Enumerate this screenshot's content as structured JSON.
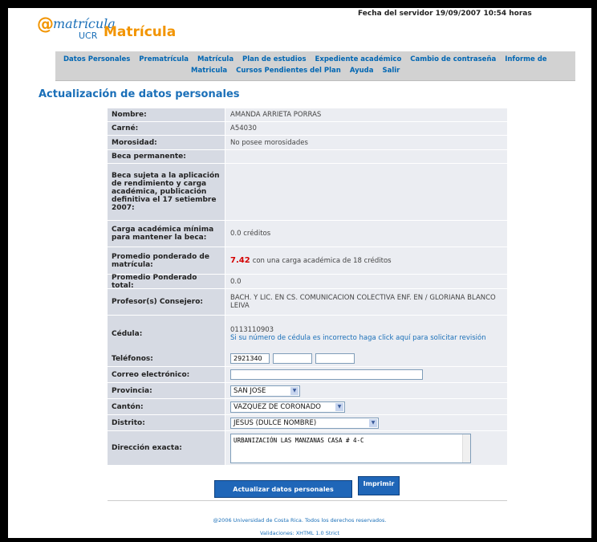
{
  "header": {
    "logo_text": "matrícula",
    "logo_sub": "UCR",
    "title": "Matrícula",
    "server_time": "Fecha del servidor 19/09/2007 10:54 horas"
  },
  "nav": {
    "row1": [
      "Datos Personales",
      "Prematrícula",
      "Matrícula",
      "Plan de estudios",
      "Expediente académico",
      "Cambio de contraseña",
      "Informe de"
    ],
    "row2": [
      "Matricula",
      "Cursos Pendientes del Plan",
      "Ayuda",
      "Salir"
    ]
  },
  "section_title": "Actualización de datos personales",
  "info": {
    "nombre_label": "Nombre:",
    "nombre": "AMANDA ARRIETA PORRAS",
    "carne_label": "Carné:",
    "carne": "A54030",
    "morosidad_label": "Morosidad:",
    "morosidad": "No posee morosidades",
    "beca_perm_label": "Beca permanente:",
    "beca_perm": "",
    "beca_sujeta_label": "Beca sujeta a la aplicación de rendimiento y carga académica, publicación definitiva el 17 setiembre 2007:",
    "beca_sujeta": "",
    "carga_label": "Carga académica mínima para mantener la beca:",
    "carga": "0.0 créditos",
    "promedio_label": "Promedio ponderado de matrícula:",
    "promedio_value": "7.42",
    "promedio_text": "con una carga académica de 18 créditos",
    "promedio_total_label": "Promedio Ponderado total:",
    "promedio_total": "0.0",
    "profesor_label": "Profesor(s) Consejero:",
    "profesor": "BACH. Y LIC. EN CS. COMUNICACION COLECTIVA ENF. EN / GLORIANA BLANCO LEIVA",
    "cedula_label": "Cédula:",
    "cedula": "0113110903",
    "cedula_link": "Si su número de cédula es incorrecto haga click aquí para solicitar revisión"
  },
  "form": {
    "telefonos_label": "Teléfonos:",
    "telefono1": "2921340",
    "telefono2": "",
    "telefono3": "",
    "correo_label": "Correo electrónico:",
    "correo": "",
    "provincia_label": "Provincia:",
    "provincia": "SAN JOSE",
    "canton_label": "Cantón:",
    "canton": "VAZQUEZ DE CORONADO",
    "distrito_label": "Distrito:",
    "distrito": "JESUS (DULCE NOMBRE)",
    "direccion_label": "Dirección exacta:",
    "direccion": "URBANIZACIÓN LAS MANZANAS CASA # 4-C"
  },
  "buttons": {
    "update": "Actualizar datos personales",
    "print": "Imprimir"
  },
  "footer": {
    "copyright": "@2006 Universidad de Costa Rica. Todos los derechos reservados.",
    "validation": "Validaciones: XHTML 1.0 Strict"
  }
}
